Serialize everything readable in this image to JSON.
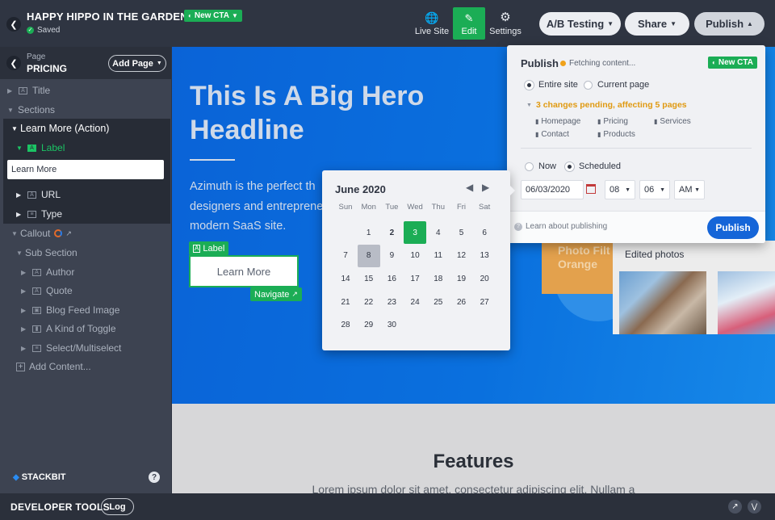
{
  "header": {
    "site_name": "HAPPY HIPPO IN THE GARDEN",
    "variant_badge": "New CTA",
    "saved_status": "Saved",
    "nav": {
      "live_site": "Live Site",
      "edit": "Edit",
      "settings": "Settings"
    },
    "ab_testing": "A/B Testing",
    "share": "Share",
    "publish": "Publish"
  },
  "sidebar": {
    "page_caption": "Page",
    "page_name": "PRICING",
    "add_page": "Add Page",
    "tree": {
      "title": "Title",
      "sections": "Sections",
      "learn_more_action": "Learn More (Action)",
      "label": "Label",
      "label_value": "Learn More",
      "url": "URL",
      "type": "Type",
      "callout": "Callout",
      "sub_section": "Sub Section",
      "author": "Author",
      "quote": "Quote",
      "blog_feed_image": "Blog Feed Image",
      "kind_of_toggle": "A Kind of Toggle",
      "select_multiselect": "Select/Multiselect",
      "add_content": "Add Content..."
    },
    "brand": "STACKBIT",
    "help": "?"
  },
  "devtools": {
    "title": "DEVELOPER TOOLS",
    "log": "Log"
  },
  "hero": {
    "headline_1": "This Is A Big Hero",
    "headline_2": "Headline",
    "body_1": "Azimuth is the perfect th",
    "body_2": "designers and entreprene",
    "body_3": "modern SaaS site.",
    "label_tag": "Label",
    "cta_button": "Learn More",
    "navigate_tag": "Navigate",
    "card_text_1": "Photo Filt",
    "card_text_2": "Orange",
    "edited_photos": "Edited photos"
  },
  "features": {
    "title": "Features",
    "body": "Lorem ipsum dolor sit amet, consectetur adipiscing elit. Nullam a"
  },
  "publish_panel": {
    "title": "Publish",
    "fetching": "Fetching content...",
    "badge": "New CTA",
    "scope_entire": "Entire site",
    "scope_current": "Current page",
    "pending": "3 changes pending, affecting 5 pages",
    "pages": [
      "Homepage",
      "Pricing",
      "Services",
      "Contact",
      "Products"
    ],
    "when_now": "Now",
    "when_scheduled": "Scheduled",
    "date": "06/03/2020",
    "hour": "08",
    "minute": "06",
    "ampm": "AM",
    "learn_link": "Learn about publishing",
    "publish_button": "Publish"
  },
  "calendar": {
    "month": "June 2020",
    "weekdays": [
      "Sun",
      "Mon",
      "Tue",
      "Wed",
      "Thu",
      "Fri",
      "Sat"
    ],
    "first_weekday_index": 1,
    "days_in_month": 30,
    "selected_day": 3,
    "today_day": 8,
    "bold_day": 2
  },
  "colors": {
    "accent_green": "#1bad55",
    "publish_blue": "#1565d8",
    "pending_orange": "#e09a12",
    "hero_blue": "#0a68da"
  }
}
